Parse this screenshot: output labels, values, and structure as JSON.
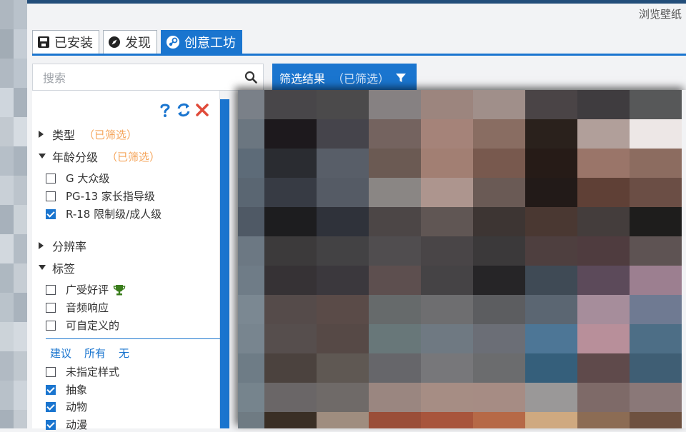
{
  "header": {
    "browse_label": "浏览壁纸"
  },
  "tabs": [
    {
      "label": "已安装",
      "icon": "save-icon"
    },
    {
      "label": "发现",
      "icon": "compass-icon"
    },
    {
      "label": "创意工坊",
      "icon": "steam-icon",
      "active": true
    }
  ],
  "search": {
    "placeholder": "搜索",
    "value": ""
  },
  "filter_button": {
    "label": "筛选结果",
    "sub": "（已筛选）"
  },
  "sections": {
    "type": {
      "label": "类型",
      "note": "（已筛选）",
      "expanded": false
    },
    "age": {
      "label": "年龄分级",
      "note": "（已筛选）",
      "expanded": true
    },
    "resolution": {
      "label": "分辨率",
      "expanded": false
    },
    "tags": {
      "label": "标签",
      "expanded": true
    }
  },
  "age_options": [
    {
      "label": "G 大众级",
      "checked": false
    },
    {
      "label": "PG-13 家长指导级",
      "checked": false
    },
    {
      "label": "R-18 限制级/成人级",
      "checked": true
    }
  ],
  "tag_options": [
    {
      "label": "广受好评",
      "checked": false,
      "icon": "trophy-icon"
    },
    {
      "label": "音频响应",
      "checked": false
    },
    {
      "label": "可自定义的",
      "checked": false
    }
  ],
  "tag_links": {
    "suggest": "建议",
    "all": "所有",
    "none": "无"
  },
  "style_options": [
    {
      "label": "未指定样式",
      "checked": false
    },
    {
      "label": "抽象",
      "checked": true
    },
    {
      "label": "动物",
      "checked": true
    },
    {
      "label": "动漫",
      "checked": true
    }
  ],
  "colors": {
    "accent": "#1a75cf",
    "note": "#f5a55b",
    "trophy": "#3a7d1c",
    "close": "#e04b3a",
    "strip": [
      "#aeb7c0",
      "#b9c2cb",
      "#a2acb5",
      "#c5cdd5",
      "#b0b9c2",
      "#bcc5ce",
      "#cfd6dd",
      "#a8b2bc",
      "#c2c9d0",
      "#d6dce2",
      "#b6bfc8",
      "#aab4be",
      "#c9d0d7",
      "#bcc4cc",
      "#a7b1bb",
      "#cbd2d8",
      "#d2d8de",
      "#b3bcc5",
      "#aeb8c1",
      "#c6cdd4",
      "#bac3cb",
      "#a9b3bd",
      "#ccd3d9",
      "#d4dae0",
      "#b1bac3",
      "#c0c8cf",
      "#b8c1c9",
      "#cdd4db",
      "#a6b0ba",
      "#c3cad1"
    ],
    "mosaic": [
      "#7a8088",
      "#484649",
      "#4b4a4b",
      "#868182",
      "#9c857e",
      "#a08f8a",
      "#4a4446",
      "#3f3c3f",
      "#575859",
      "#6b7680",
      "#1d191d",
      "#45444b",
      "#74635f",
      "#a58379",
      "#896d62",
      "#2a211c",
      "#b19f9a",
      "#ede7e6",
      "#5d6b78",
      "#2a2c31",
      "#585e68",
      "#6b5a53",
      "#a27f73",
      "#78594e",
      "#261b17",
      "#9a7569",
      "#8c6c60",
      "#5a6672",
      "#373b44",
      "#555b65",
      "#8a8684",
      "#ad958e",
      "#6a5a55",
      "#221a18",
      "#5f4036",
      "#6b4e45",
      "#4f5965",
      "#1d1d1f",
      "#2f323a",
      "#4c4646",
      "#605654",
      "#3d3533",
      "#4a3832",
      "#443d3c",
      "#1e1d1c",
      "#6c7883",
      "#3c3a3b",
      "#434244",
      "#504d4f",
      "#494547",
      "#3b393a",
      "#4e3f3f",
      "#4f3c3f",
      "#5e5353",
      "#6f7c87",
      "#363235",
      "#3b383d",
      "#5d4f4f",
      "#454345",
      "#262527",
      "#3f4a55",
      "#5c4a5a",
      "#9c7f90",
      "#7b8892",
      "#554b4a",
      "#5a4b48",
      "#666a6b",
      "#6e6e70",
      "#5c5d60",
      "#5b6672",
      "#a68d9b",
      "#6f7a92",
      "#78858f",
      "#564e4d",
      "#564946",
      "#687779",
      "#6f7982",
      "#6b6e76",
      "#4d7696",
      "#b88f9a",
      "#4d6e86",
      "#6e7c86",
      "#4b423e",
      "#5f5853",
      "#66666a",
      "#77777a",
      "#6b6c6e",
      "#355f7b",
      "#5f4a4b",
      "#3f5e74",
      "#76848d",
      "#6a6667",
      "#6f6a68",
      "#9a8680",
      "#a68d84",
      "#a68c84",
      "#9a9898",
      "#7e6a68",
      "#8a7878",
      "#6f7b83",
      "#3a2f25",
      "#9f8d7f",
      "#9a4e38",
      "#a8553c",
      "#b66947",
      "#cfa980",
      "#8c6c54",
      "#6e5140"
    ]
  }
}
